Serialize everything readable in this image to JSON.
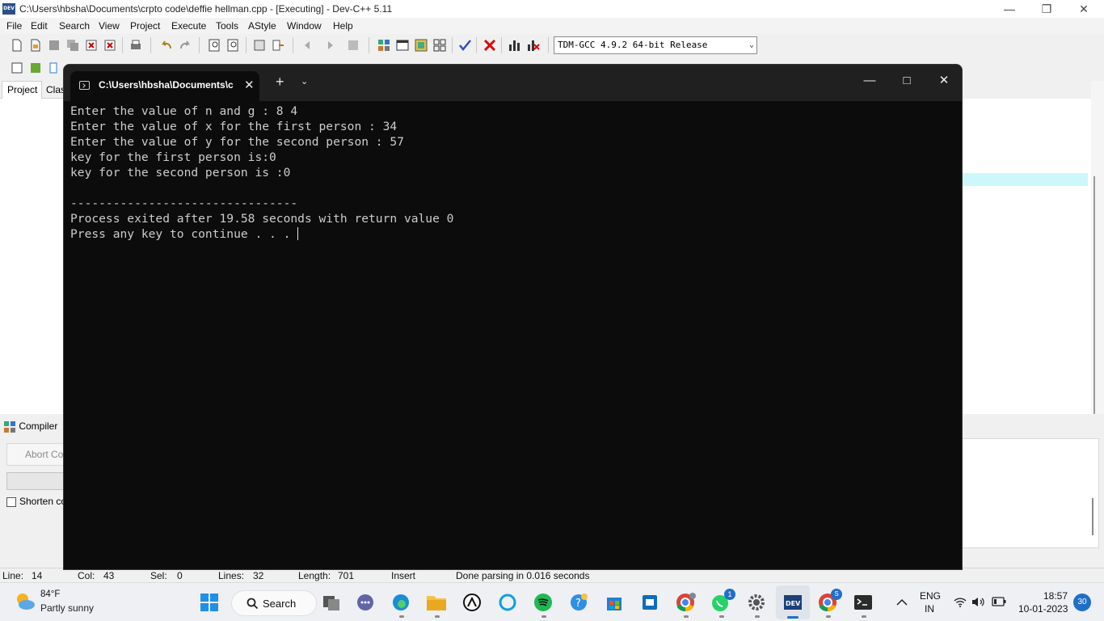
{
  "devcpp": {
    "window_title": "C:\\Users\\hbsha\\Documents\\crpto code\\deffie hellman.cpp - [Executing] - Dev-C++ 5.11",
    "app_icon_text": "DEV",
    "menu": [
      "File",
      "Edit",
      "Search",
      "View",
      "Project",
      "Execute",
      "Tools",
      "AStyle",
      "Window",
      "Help"
    ],
    "compiler_select": "TDM-GCC 4.9.2 64-bit Release",
    "left_tabs": {
      "project": "Project",
      "classes": "Clas"
    },
    "bottom": {
      "compiler_tab": "Compiler",
      "abort_button": "Abort Co",
      "shorten_label": "Shorten co",
      "shorten_checked": false
    },
    "status": {
      "line_label": "Line:",
      "line_value": "14",
      "col_label": "Col:",
      "col_value": "43",
      "sel_label": "Sel:",
      "sel_value": "0",
      "lines_label": "Lines:",
      "lines_value": "32",
      "length_label": "Length:",
      "length_value": "701",
      "mode": "Insert",
      "message": "Done parsing in 0.016 seconds"
    }
  },
  "terminal": {
    "tab_title": "C:\\Users\\hbsha\\Documents\\c",
    "lines": [
      "Enter the value of n and g : 8 4",
      "Enter the value of x for the first person : 34",
      "Enter the value of y for the second person : 57",
      "key for the first person is:0",
      "key for the second person is :0",
      "",
      "--------------------------------",
      "Process exited after 19.58 seconds with return value 0"
    ],
    "prompt_line": "Press any key to continue . . . "
  },
  "taskbar": {
    "weather_temp": "84°F",
    "weather_condition": "Partly sunny",
    "search_label": "Search",
    "whatsapp_badge": "1",
    "chrome_badge": "S",
    "lang_line1": "ENG",
    "lang_line2": "IN",
    "time": "18:57",
    "date": "10-01-2023",
    "notification_count": "30"
  },
  "colors": {
    "terminal_bg": "#0c0c0c",
    "terminal_text": "#cccccc",
    "terminal_titlebar": "#202020",
    "editor_highlight": "#cdf8fb",
    "taskbar_bg": "#eef0f4"
  }
}
